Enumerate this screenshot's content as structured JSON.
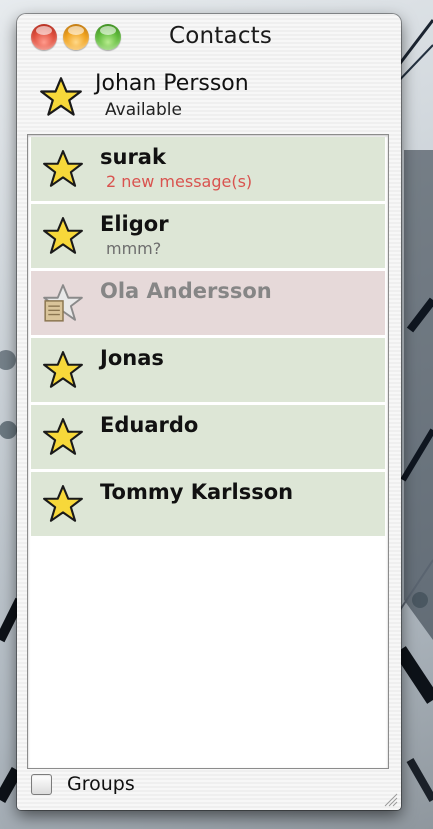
{
  "window": {
    "title": "Contacts"
  },
  "me": {
    "name": "Johan Persson",
    "status": "Available",
    "icon": "star-icon"
  },
  "contacts": [
    {
      "name": "surak",
      "subtitle": "2 new message(s)",
      "state": "online",
      "subtitle_style": "alert",
      "icon": "star-icon"
    },
    {
      "name": "Eligor",
      "subtitle": "mmm?",
      "state": "online",
      "subtitle_style": "normal",
      "icon": "star-icon"
    },
    {
      "name": "Ola Andersson",
      "subtitle": "",
      "state": "offline",
      "subtitle_style": "normal",
      "icon": "offline-star-note-icon"
    },
    {
      "name": "Jonas",
      "subtitle": "",
      "state": "online",
      "subtitle_style": "normal",
      "icon": "star-icon"
    },
    {
      "name": "Eduardo",
      "subtitle": "",
      "state": "online",
      "subtitle_style": "normal",
      "icon": "star-icon"
    },
    {
      "name": "Tommy Karlsson",
      "subtitle": "",
      "state": "online",
      "subtitle_style": "normal",
      "icon": "star-icon"
    }
  ],
  "footer": {
    "groups_label": "Groups",
    "groups_checked": false
  },
  "colors": {
    "online_row": "#dde6d6",
    "offline_row": "#e6d9d9",
    "alert_text": "#d9534f",
    "star_fill": "#f7d83a"
  }
}
